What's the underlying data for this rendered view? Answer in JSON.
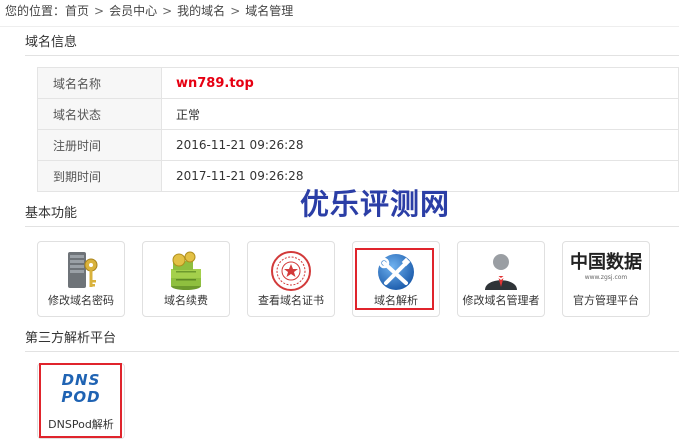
{
  "breadcrumb": {
    "prefix": "您的位置：",
    "items": [
      "首页",
      "会员中心",
      "我的域名",
      "域名管理"
    ],
    "separator": ">"
  },
  "domain_info": {
    "section_title": "域名信息",
    "rows": [
      {
        "label": "域名名称",
        "value": "wn789.top"
      },
      {
        "label": "域名状态",
        "value": "正常"
      },
      {
        "label": "注册时间",
        "value": "2016-11-21 09:26:28"
      },
      {
        "label": "到期时间",
        "value": "2017-11-21 09:26:28"
      }
    ]
  },
  "basic_functions": {
    "section_title": "基本功能",
    "items": [
      {
        "label": "修改域名密码",
        "icon": "server-key-icon"
      },
      {
        "label": "域名续费",
        "icon": "money-stack-icon"
      },
      {
        "label": "查看域名证书",
        "icon": "certificate-seal-icon"
      },
      {
        "label": "域名解析",
        "icon": "tools-globe-icon"
      },
      {
        "label": "修改域名管理者",
        "icon": "user-avatar-icon"
      },
      {
        "label": "官方管理平台",
        "icon": "zgsj-logo-icon",
        "logo_text": "中国数据",
        "logo_sub": "www.zgsj.com"
      }
    ]
  },
  "third_party": {
    "section_title": "第三方解析平台",
    "items": [
      {
        "label": "DNSPod解析",
        "icon": "dnspod-logo-icon",
        "logo_line1": "DNS",
        "logo_line2": "POD"
      }
    ]
  },
  "watermark": "优乐评测网",
  "colors": {
    "highlight_border": "#e0242c",
    "domain_name_red": "#e60012",
    "watermark_blue": "#2b3ea6",
    "dnspod_blue": "#1f63b3"
  }
}
